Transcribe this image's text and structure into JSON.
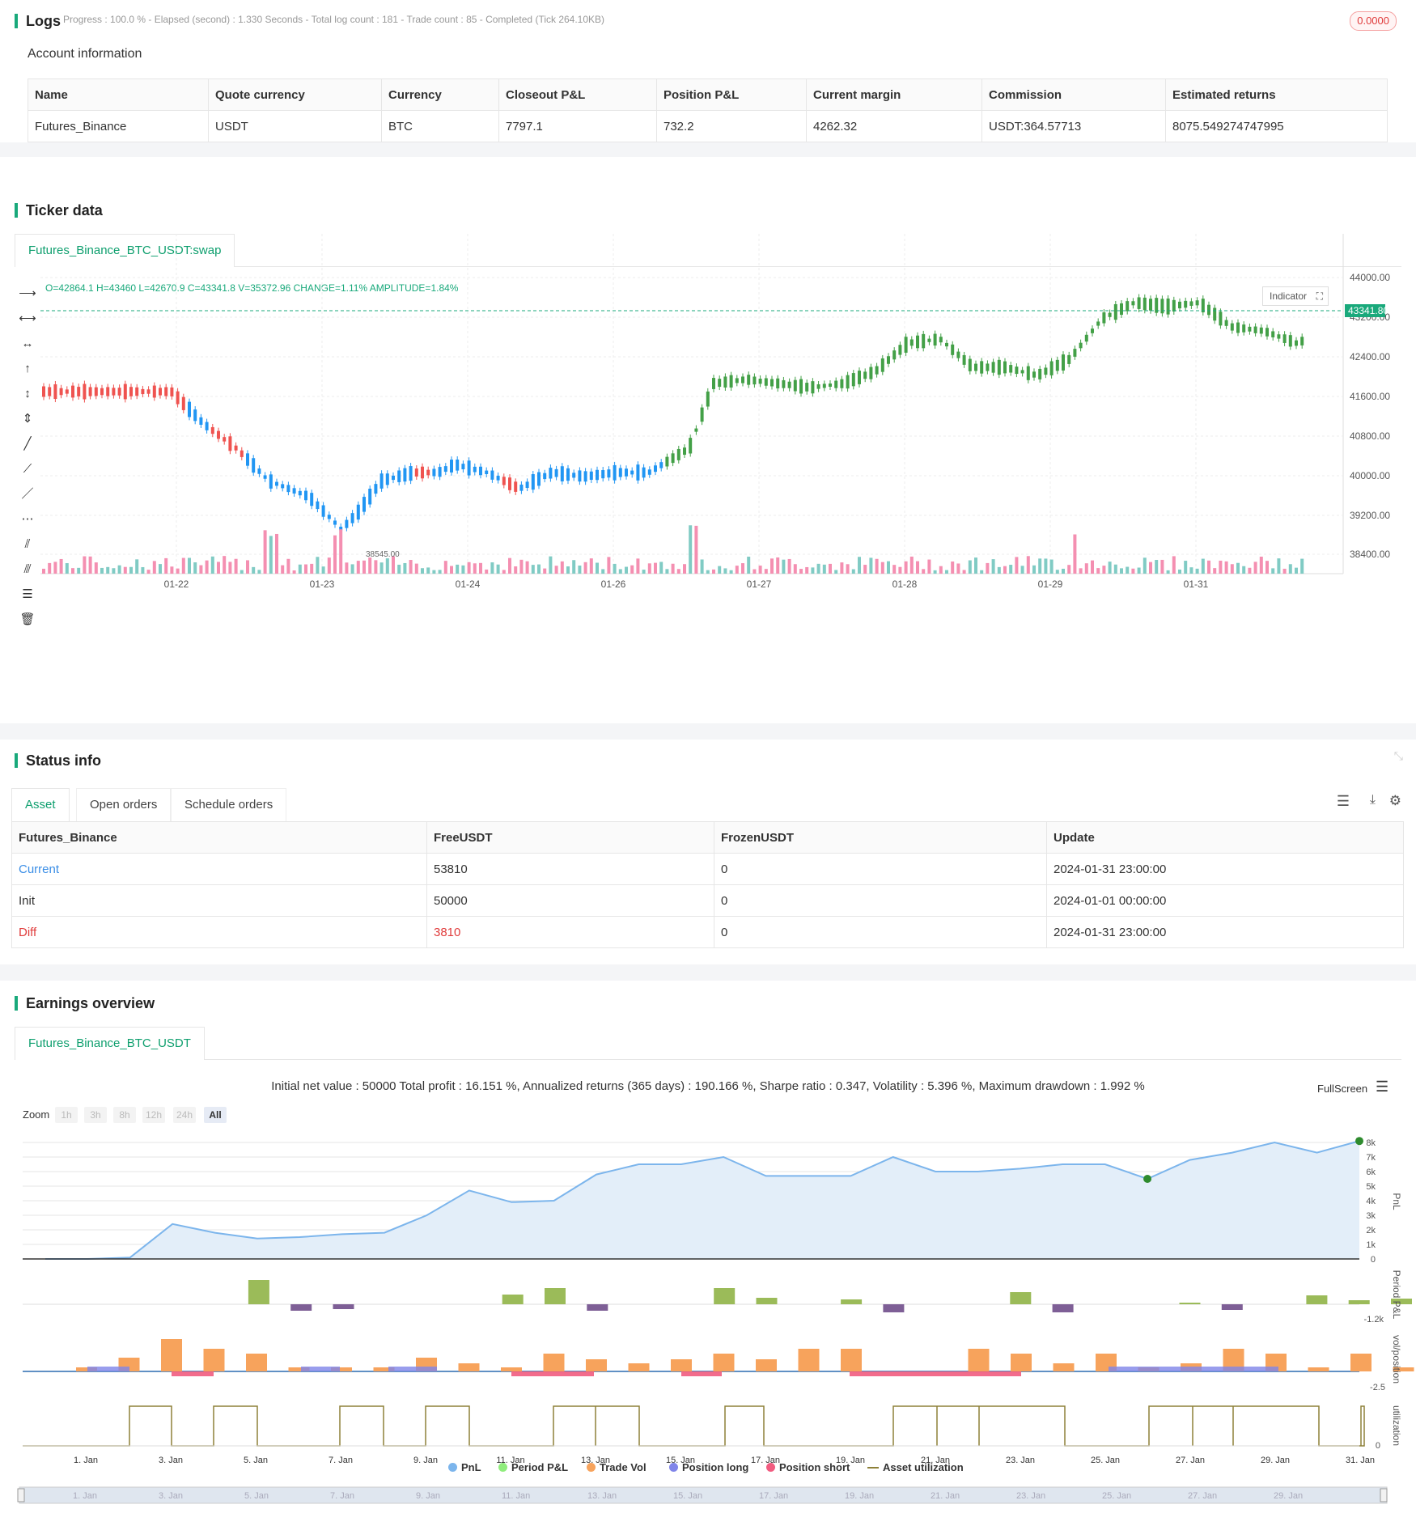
{
  "logs": {
    "title": "Logs",
    "status": "Progress : 100.0 % - Elapsed (second) : 1.330  Seconds - Total log count : 181 - Trade count : 85 - Completed (Tick 264.10KB)",
    "badge": "0.0000"
  },
  "account": {
    "title": "Account information",
    "headers": [
      "Name",
      "Quote currency",
      "Currency",
      "Closeout P&L",
      "Position P&L",
      "Current margin",
      "Commission",
      "Estimated returns"
    ],
    "row": [
      "Futures_Binance",
      "USDT",
      "BTC",
      "7797.1",
      "732.2",
      "4262.32",
      "USDT:364.57713",
      "8075.549274747995"
    ]
  },
  "ticker": {
    "title": "Ticker data",
    "tab": "Futures_Binance_BTC_USDT:swap",
    "ohlc": "O=42864.1 H=43460 L=42670.9 C=43341.8 V=35372.96 CHANGE=1.11% AMPLITUDE=1.84%",
    "indicator_label": "Indicator",
    "last_price": "43341.80",
    "low_label": "38545.00",
    "x_labels": [
      "01-22",
      "01-23",
      "01-24",
      "01-26",
      "01-27",
      "01-28",
      "01-29",
      "01-31"
    ],
    "y_labels": [
      "44000.00",
      "43200.00",
      "42400.00",
      "41600.00",
      "40800.00",
      "40000.00",
      "39200.00",
      "38400.00"
    ]
  },
  "status": {
    "title": "Status info",
    "tabs": [
      "Asset",
      "Open orders",
      "Schedule orders"
    ],
    "headers": [
      "Futures_Binance",
      "FreeUSDT",
      "FrozenUSDT",
      "Update"
    ],
    "rows": [
      [
        "Current",
        "53810",
        "0",
        "2024-01-31 23:00:00"
      ],
      [
        "Init",
        "50000",
        "0",
        "2024-01-01 00:00:00"
      ],
      [
        "Diff",
        "3810",
        "0",
        "2024-01-31 23:00:00"
      ]
    ]
  },
  "earnings": {
    "title": "Earnings overview",
    "tab": "Futures_Binance_BTC_USDT",
    "summary": "Initial net value : 50000 Total profit : 16.151 %, Annualized returns (365 days) : 190.166 %, Sharpe ratio : 0.347, Volatility : 5.396 %, Maximum drawdown : 1.992 %",
    "fullscreen": "FullScreen",
    "zoom_label": "Zoom",
    "zoom_options": [
      "1h",
      "3h",
      "8h",
      "12h",
      "24h",
      "All"
    ],
    "pnl_y_labels": [
      "8k",
      "7k",
      "6k",
      "5k",
      "4k",
      "3k",
      "2k",
      "1k",
      "0"
    ],
    "axis_titles": [
      "PnL",
      "Period P&L",
      "vol/position",
      "utilization"
    ],
    "period_min": "-1.2k",
    "vol_min": "-2.5",
    "util_zero": "0",
    "x_labels": [
      "1. Jan",
      "3. Jan",
      "5. Jan",
      "7. Jan",
      "9. Jan",
      "11. Jan",
      "13. Jan",
      "15. Jan",
      "17. Jan",
      "19. Jan",
      "21. Jan",
      "23. Jan",
      "25. Jan",
      "27. Jan",
      "29. Jan",
      "31. Jan"
    ],
    "legend": [
      {
        "label": "PnL",
        "color": "#7cb5ec"
      },
      {
        "label": "Period P&L",
        "color": "#90ed7d"
      },
      {
        "label": "Trade Vol",
        "color": "#f7a35c"
      },
      {
        "label": "Position long",
        "color": "#8085e9"
      },
      {
        "label": "Position short",
        "color": "#f15c80"
      },
      {
        "label": "Asset utilization",
        "color": "#8d8038"
      }
    ],
    "navigator_labels": [
      "1. Jan",
      "3. Jan",
      "5. Jan",
      "7. Jan",
      "9. Jan",
      "11. Jan",
      "13. Jan",
      "15. Jan",
      "17. Jan",
      "19. Jan",
      "21. Jan",
      "23. Jan",
      "25. Jan",
      "27. Jan",
      "29. Jan"
    ],
    "pnl_values": [
      0,
      0,
      100,
      2400,
      1800,
      1400,
      1500,
      1700,
      1800,
      3000,
      4700,
      3900,
      4000,
      5800,
      6500,
      6500,
      7000,
      5700,
      5700,
      5700,
      7000,
      6000,
      6000,
      6200,
      6500,
      6500,
      5500,
      6800,
      7300,
      8000,
      7300,
      8100
    ]
  }
}
